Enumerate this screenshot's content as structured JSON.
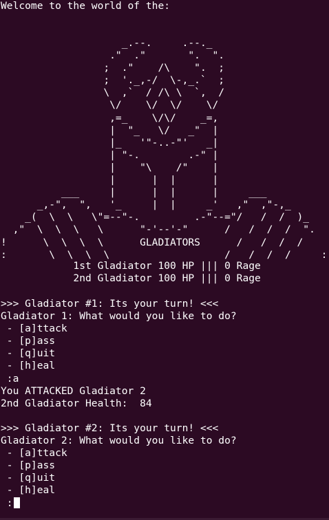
{
  "terminal": {
    "welcome": "Welcome to the world of the:",
    "ascii_art": [
      "                    _.--.     .--._",
      "                  .\"  .\"       \".  \".",
      "                 ;  .\"    /\\    \".  ;",
      "                 ;  '._,-/  \\-,_.`  ;",
      "                 \\  ,`  / /\\ \\  `,  /",
      "                  \\/    \\/  \\/    \\/",
      "                  ,=_    \\/\\/    _=,",
      "                  |  \"_   \\/   _\"  |",
      "                  |_   '\"-..-\"'   _|",
      "                  | \"-.        .-\" |",
      "                  |    \"\\    /\"    |",
      "                  |      |  |      |",
      "          ___     |      |  |      |     ___",
      "      _,-\",  \",   '_     |  |     _'   ,\"  ,\"-,_",
      "    _(  \\  \\   \\\"=--\"-.         .-\"--=\"/   /  /  )_",
      "  ,\"  \\  \\  \\   \\      \"-'--'-\"      /   /  /  /  \".",
      "!      \\  \\  \\  \\      GLADIATORS      /   /  /  /    !",
      ":       \\  \\  \\  \\                   /   /  /  /     :"
    ],
    "hp_lines": [
      "            1st Gladiator 100 HP ||| 0 Rage",
      "            2nd Gladiator 100 HP ||| 0 Rage"
    ],
    "log_lines": [
      ">>> Gladiator #1: Its your turn! <<<",
      "Gladiator 1: What would you like to do?",
      " - [a]ttack",
      " - [p]ass",
      " - [q]uit",
      " - [h]eal",
      " :a",
      "You ATTACKED Gladiator 2",
      "2nd Gladiator Health:  84",
      "",
      ">>> Gladiator #2: Its your turn! <<<",
      "Gladiator 2: What would you like to do?",
      " - [a]ttack",
      " - [p]ass",
      " - [q]uit",
      " - [h]eal"
    ],
    "prompt": " :"
  }
}
